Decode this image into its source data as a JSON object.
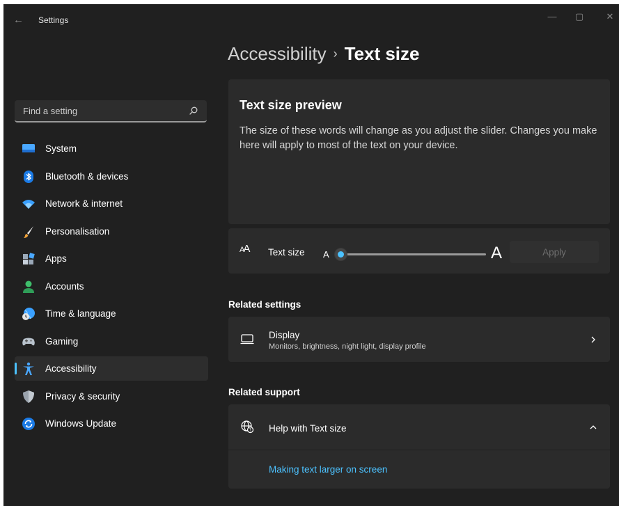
{
  "window": {
    "title": "Settings",
    "back_glyph": "←",
    "minimize_glyph": "—",
    "maximize_glyph": "▢",
    "close_glyph": "✕"
  },
  "search": {
    "placeholder": "Find a setting",
    "icon": "search-icon"
  },
  "sidebar": {
    "items": [
      {
        "label": "System",
        "icon": "system-icon",
        "selected": false
      },
      {
        "label": "Bluetooth & devices",
        "icon": "bluetooth-icon",
        "selected": false
      },
      {
        "label": "Network & internet",
        "icon": "wifi-icon",
        "selected": false
      },
      {
        "label": "Personalisation",
        "icon": "brush-icon",
        "selected": false
      },
      {
        "label": "Apps",
        "icon": "apps-icon",
        "selected": false
      },
      {
        "label": "Accounts",
        "icon": "account-icon",
        "selected": false
      },
      {
        "label": "Time & language",
        "icon": "globe-clock-icon",
        "selected": false
      },
      {
        "label": "Gaming",
        "icon": "gamepad-icon",
        "selected": false
      },
      {
        "label": "Accessibility",
        "icon": "accessibility-icon",
        "selected": true
      },
      {
        "label": "Privacy & security",
        "icon": "shield-icon",
        "selected": false
      },
      {
        "label": "Windows Update",
        "icon": "update-icon",
        "selected": false
      }
    ]
  },
  "breadcrumb": {
    "parent": "Accessibility",
    "separator": "›",
    "current": "Text size"
  },
  "preview": {
    "title": "Text size preview",
    "text": "The size of these words will change as you adjust the slider. Changes you make here will apply to most of the text on your device."
  },
  "text_size": {
    "icon": "text-size-icon",
    "label": "Text size",
    "small_a": "A",
    "large_a": "A",
    "slider_value_percent": 100,
    "slider_min": 100,
    "slider_max": 225,
    "apply_label": "Apply"
  },
  "related_settings": {
    "title": "Related settings",
    "display": {
      "title": "Display",
      "subtitle": "Monitors, brightness, night light, display profile"
    }
  },
  "related_support": {
    "title": "Related support",
    "help_title": "Help with Text size",
    "link": "Making text larger on screen"
  },
  "colors": {
    "background": "#202020",
    "card": "#2b2b2b",
    "accent": "#4cc2ff"
  }
}
